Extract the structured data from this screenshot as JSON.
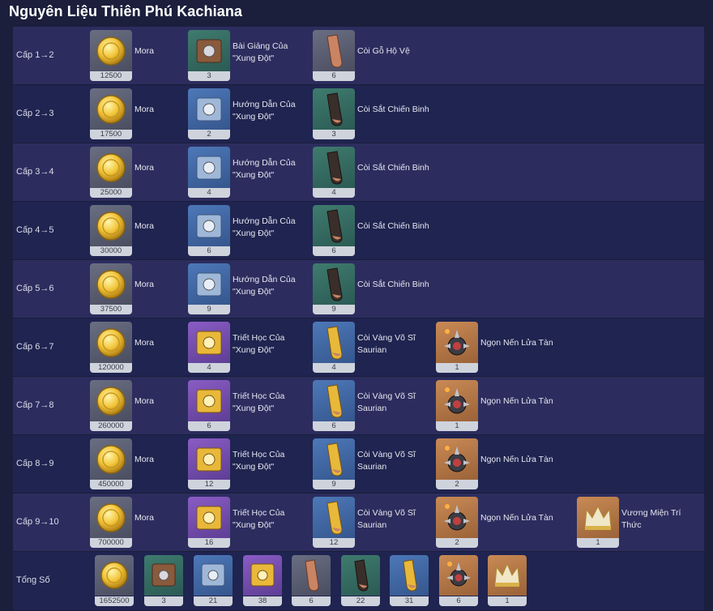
{
  "title": "Nguyên Liệu Thiên Phú Kachiana",
  "rows": [
    {
      "level": "Cấp 1→2",
      "mora": "12500",
      "mora_label": "Mora",
      "b": {
        "name": "Bài Giảng Của \"Xung Đột\"",
        "count": "3"
      },
      "c": {
        "name": "Còi Gỗ Hộ Vệ",
        "count": "6"
      }
    },
    {
      "level": "Cấp 2→3",
      "mora": "17500",
      "mora_label": "Mora",
      "b": {
        "name": "Hướng Dẫn Của \"Xung Đột\"",
        "count": "2"
      },
      "c": {
        "name": "Còi Sắt Chiến Binh",
        "count": "3"
      }
    },
    {
      "level": "Cấp 3→4",
      "mora": "25000",
      "mora_label": "Mora",
      "b": {
        "name": "Hướng Dẫn Của \"Xung Đột\"",
        "count": "4"
      },
      "c": {
        "name": "Còi Sắt Chiến Binh",
        "count": "4"
      }
    },
    {
      "level": "Cấp 4→5",
      "mora": "30000",
      "mora_label": "Mora",
      "b": {
        "name": "Hướng Dẫn Của \"Xung Đột\"",
        "count": "6"
      },
      "c": {
        "name": "Còi Sắt Chiến Binh",
        "count": "6"
      }
    },
    {
      "level": "Cấp 5→6",
      "mora": "37500",
      "mora_label": "Mora",
      "b": {
        "name": "Hướng Dẫn Của \"Xung Đột\"",
        "count": "9"
      },
      "c": {
        "name": "Còi Sắt Chiến Binh",
        "count": "9"
      }
    },
    {
      "level": "Cấp 6→7",
      "mora": "120000",
      "mora_label": "Mora",
      "b": {
        "name": "Triết Học Của \"Xung Đột\"",
        "count": "4"
      },
      "c": {
        "name": "Còi Vàng Võ Sĩ Saurian",
        "count": "4"
      },
      "d": {
        "name": "Ngọn Nến Lửa Tàn",
        "count": "1"
      }
    },
    {
      "level": "Cấp 7→8",
      "mora": "260000",
      "mora_label": "Mora",
      "b": {
        "name": "Triết Học Của \"Xung Đột\"",
        "count": "6"
      },
      "c": {
        "name": "Còi Vàng Võ Sĩ Saurian",
        "count": "6"
      },
      "d": {
        "name": "Ngọn Nến Lửa Tàn",
        "count": "1"
      }
    },
    {
      "level": "Cấp 8→9",
      "mora": "450000",
      "mora_label": "Mora",
      "b": {
        "name": "Triết Học Của \"Xung Đột\"",
        "count": "12"
      },
      "c": {
        "name": "Còi Vàng Võ Sĩ Saurian",
        "count": "9"
      },
      "d": {
        "name": "Ngọn Nến Lửa Tàn",
        "count": "2"
      }
    },
    {
      "level": "Cấp 9→10",
      "mora": "700000",
      "mora_label": "Mora",
      "b": {
        "name": "Triết Học Của \"Xung Đột\"",
        "count": "16"
      },
      "c": {
        "name": "Còi Vàng Võ Sĩ Saurian",
        "count": "12"
      },
      "d": {
        "name": "Ngọn Nến Lửa Tàn",
        "count": "2"
      },
      "e": {
        "name": "Vương Miện Trí Thức",
        "count": "1"
      }
    }
  ],
  "total": {
    "label": "Tổng Số",
    "counts": [
      "1652500",
      "3",
      "21",
      "38",
      "6",
      "22",
      "31",
      "6",
      "1"
    ]
  }
}
